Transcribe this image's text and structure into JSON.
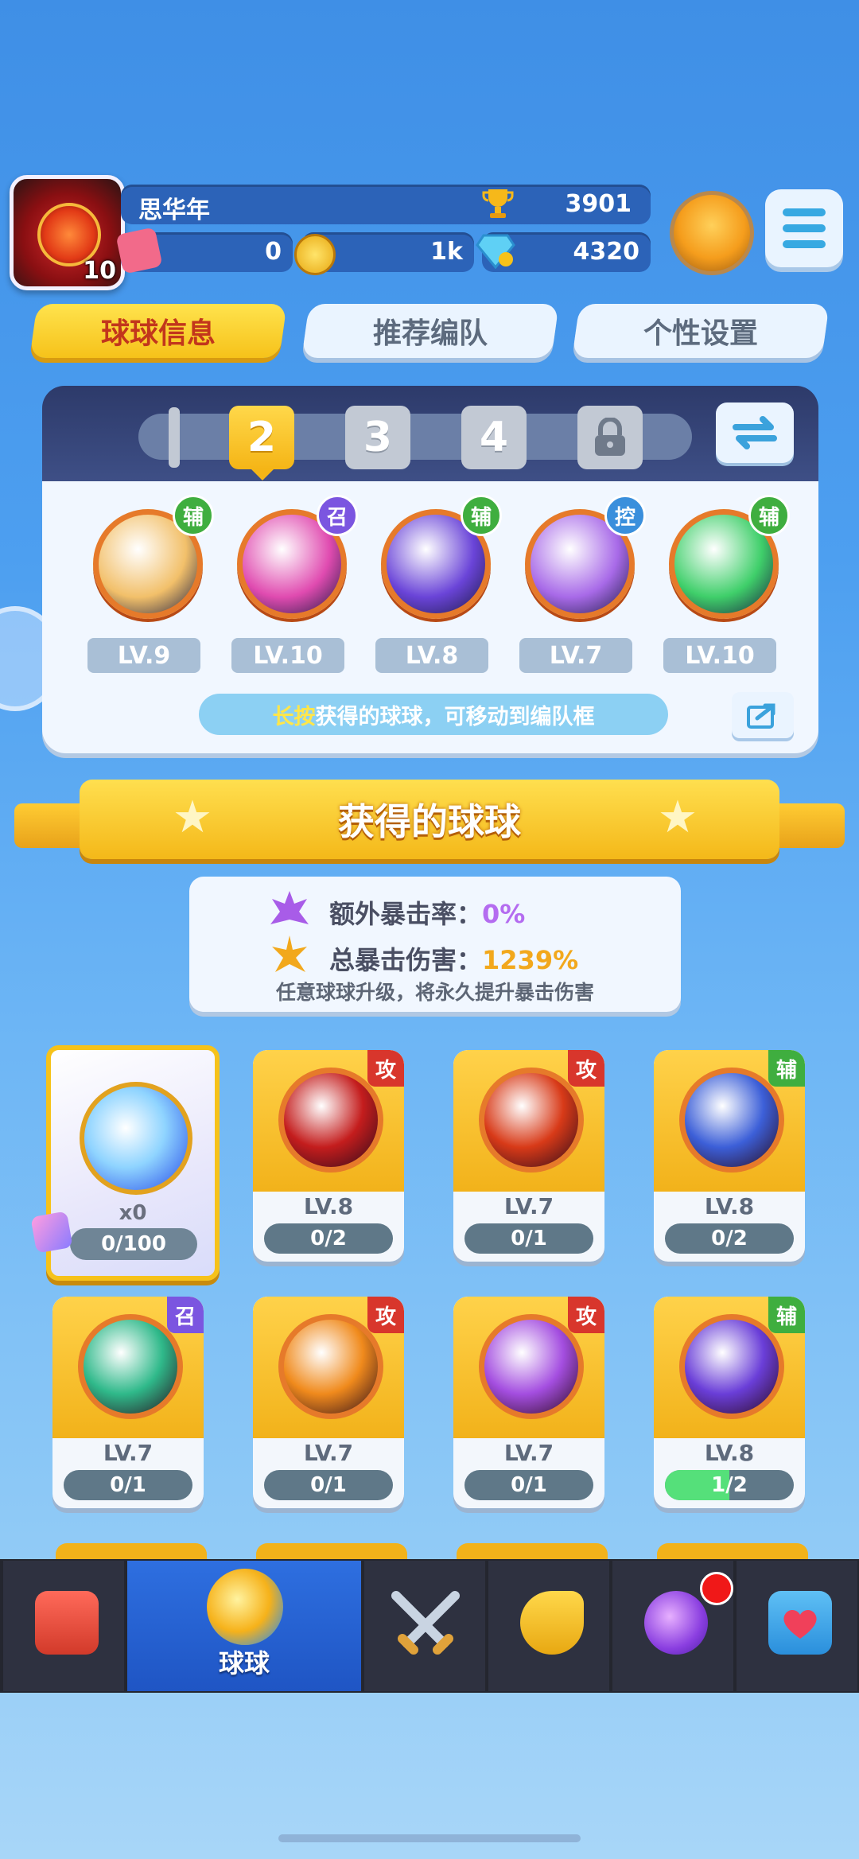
{
  "player": {
    "name": "思华年",
    "level": "10",
    "trophies": "3901",
    "tickets": "0",
    "gold": "1k",
    "gems": "4320"
  },
  "tabs": [
    "球球信息",
    "推荐编队",
    "个性设置"
  ],
  "team": {
    "slots": [
      "1",
      "2",
      "3",
      "4"
    ],
    "selected_slot": "2",
    "balls": [
      {
        "tag": "辅",
        "tag_color": "#3fae3f",
        "level": "LV.9",
        "color": "#f2c06a"
      },
      {
        "tag": "召",
        "tag_color": "#7b55e0",
        "level": "LV.10",
        "color": "#e04bb0"
      },
      {
        "tag": "辅",
        "tag_color": "#3fae3f",
        "level": "LV.8",
        "color": "#6a44d8"
      },
      {
        "tag": "控",
        "tag_color": "#3a8fdc",
        "level": "LV.7",
        "color": "#a86ae8"
      },
      {
        "tag": "辅",
        "tag_color": "#3fae3f",
        "level": "LV.10",
        "color": "#3fcf6a"
      }
    ],
    "hint_highlight": "长按",
    "hint_rest": "获得的球球，可移动到编队框"
  },
  "banner_title": "获得的球球",
  "crit": {
    "extra_rate_label": "额外暴击率：",
    "extra_rate_value": "0%",
    "total_damage_label": "总暴击伤害：",
    "total_damage_value": "1239%",
    "note": "任意球球升级，将永久提升暴击伤害"
  },
  "special_card": {
    "count": "x0",
    "progress": "0/100"
  },
  "cards": [
    {
      "tag": "攻",
      "level": "LV.8",
      "progress": "0/2",
      "fraction": 0,
      "color": "#c41d1d"
    },
    {
      "tag": "攻",
      "level": "LV.7",
      "progress": "0/1",
      "fraction": 0,
      "color": "#d83a18"
    },
    {
      "tag": "辅",
      "level": "LV.8",
      "progress": "0/2",
      "fraction": 0,
      "color": "#3c5fd8"
    },
    {
      "tag": "召",
      "level": "LV.7",
      "progress": "0/1",
      "fraction": 0,
      "color": "#2fb98a"
    },
    {
      "tag": "攻",
      "level": "LV.7",
      "progress": "0/1",
      "fraction": 0,
      "color": "#f08a1c"
    },
    {
      "tag": "攻",
      "level": "LV.7",
      "progress": "0/1",
      "fraction": 0,
      "color": "#a44ee0"
    },
    {
      "tag": "辅",
      "level": "LV.8",
      "progress": "1/2",
      "fraction": 0.5,
      "color": "#6a3ed8"
    }
  ],
  "nav": {
    "active_label": "球球"
  }
}
